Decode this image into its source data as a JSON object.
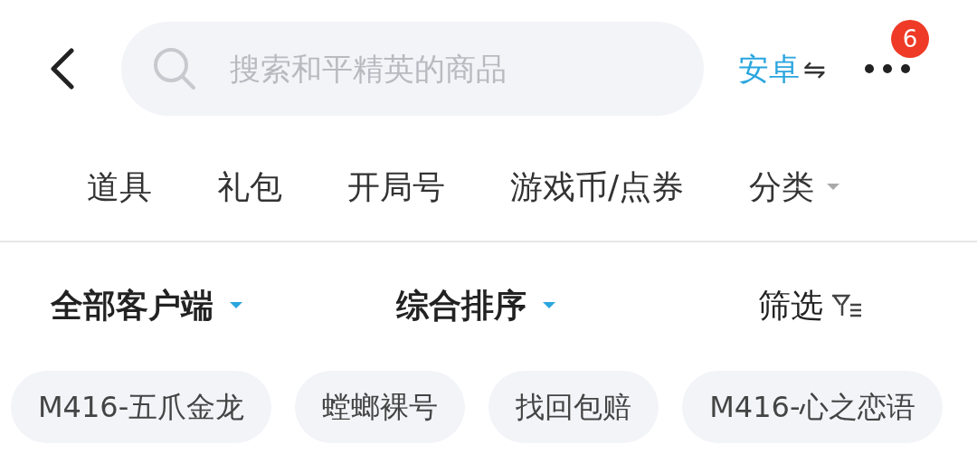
{
  "search": {
    "placeholder": "搜索和平精英的商品"
  },
  "platform": {
    "label": "安卓",
    "swap_icon": "⇋",
    "selected": true
  },
  "more": {
    "badge": "6"
  },
  "categories": [
    {
      "label": "道具"
    },
    {
      "label": "礼包"
    },
    {
      "label": "开局号"
    },
    {
      "label": "游戏币/点券"
    },
    {
      "label": "分类",
      "dropdown": true
    }
  ],
  "sort_bar": [
    {
      "label": "全部客户端",
      "kind": "dropdown"
    },
    {
      "label": "综合排序",
      "kind": "dropdown"
    },
    {
      "label": "筛选",
      "kind": "filter"
    }
  ],
  "tags": [
    "M416-五爪金龙",
    "螳螂裸号",
    "找回包赔",
    "M416-心之恋语"
  ]
}
